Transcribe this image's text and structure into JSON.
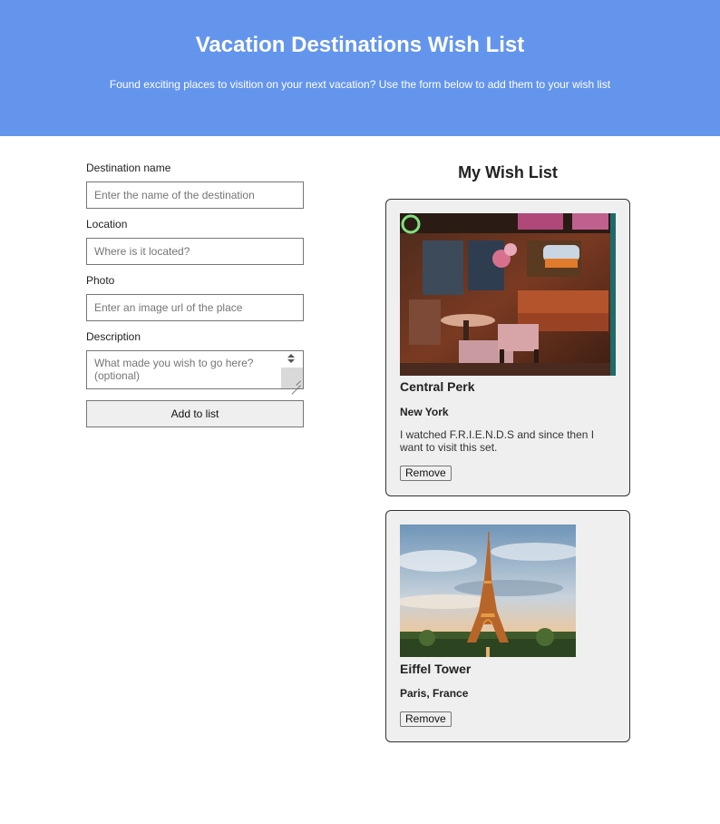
{
  "header": {
    "title": "Vacation Destinations Wish List",
    "subtitle": "Found exciting places to visition on your next vacation? Use the form below to add them to your wish list",
    "background_color": "#6495ed"
  },
  "form": {
    "destination": {
      "label": "Destination name",
      "placeholder": "Enter the name of the destination",
      "value": ""
    },
    "location": {
      "label": "Location",
      "placeholder": "Where is it located?",
      "value": ""
    },
    "photo": {
      "label": "Photo",
      "placeholder": "Enter an image url of the place",
      "value": ""
    },
    "description": {
      "label": "Description",
      "placeholder": "What made you wish to go here? (optional)",
      "value": ""
    },
    "submit_label": "Add to list"
  },
  "wishlist": {
    "title": "My Wish List",
    "items": [
      {
        "name": "Central Perk",
        "location": "New York",
        "description": "I watched F.R.I.E.N.D.S and since then I want to visit this set.",
        "photo_icon": "cafe-interior-photo",
        "remove_label": "Remove"
      },
      {
        "name": "Eiffel Tower",
        "location": "Paris, France",
        "description": "",
        "photo_icon": "eiffel-tower-photo",
        "remove_label": "Remove"
      }
    ]
  },
  "colors": {
    "card_background": "#efefef",
    "card_border": "#333333"
  }
}
